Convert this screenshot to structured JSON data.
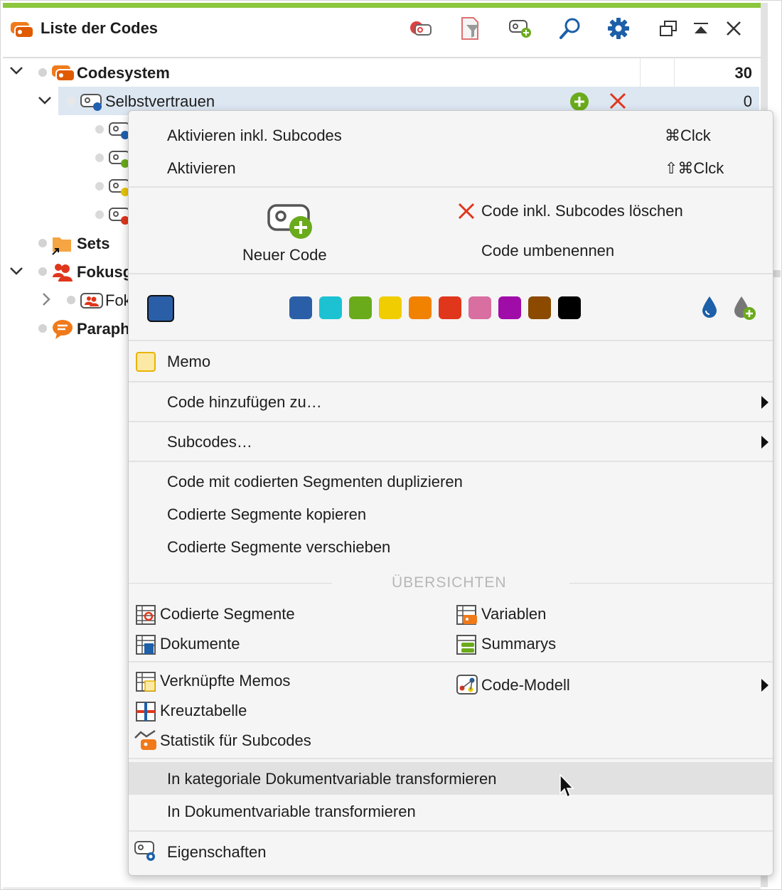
{
  "window": {
    "title": "Liste der Codes",
    "accent_color": "#8cc63e"
  },
  "toolbar": {
    "icons": [
      "code-history-icon",
      "filter-icon",
      "new-code-icon",
      "search-icon",
      "gear-icon",
      "undock-icon",
      "collapse-up-icon",
      "close-icon"
    ]
  },
  "tree": {
    "root": {
      "label": "Codesystem",
      "count": "30"
    },
    "selected": {
      "label": "Selbstvertrauen",
      "count": "0"
    },
    "subcode_colors": [
      "#2060b0",
      "#6aab1c",
      "#e8c400",
      "#e0361c"
    ],
    "sets": {
      "label": "Sets"
    },
    "focus_group": {
      "label": "Fokusg"
    },
    "focus_child": {
      "label": "Fok"
    },
    "paraphrase": {
      "label": "Paraph"
    }
  },
  "menu": {
    "activate_with_sub": {
      "label": "Aktivieren inkl. Subcodes",
      "shortcut": "⌘Clck"
    },
    "activate": {
      "label": "Aktivieren",
      "shortcut": "⇧⌘Clck"
    },
    "new_code": "Neuer Code",
    "delete_code": "Code inkl. Subcodes löschen",
    "rename_code": "Code umbenennen",
    "current_color": "#2a5fa8",
    "palette": [
      "#2a5fa8",
      "#1cc2d2",
      "#6aab1c",
      "#f0cd00",
      "#f08200",
      "#e0361c",
      "#d96ea0",
      "#a00ca8",
      "#8b4a00",
      "#000000"
    ],
    "memo": "Memo",
    "add_code_to": "Code hinzufügen zu…",
    "subcodes": "Subcodes…",
    "duplicate": "Code mit codierten Segmenten duplizieren",
    "copy_segments": "Codierte Segmente kopieren",
    "move_segments": "Codierte Segmente verschieben",
    "overview_header": "ÜBERSICHTEN",
    "coded_segments": "Codierte Segmente",
    "variables": "Variablen",
    "documents": "Dokumente",
    "summaries": "Summarys",
    "linked_memos": "Verknüpfte Memos",
    "code_model": "Code-Modell",
    "crosstab": "Kreuztabelle",
    "statistics": "Statistik für Subcodes",
    "transform_categorical": "In kategoriale Dokumentvariable transformieren",
    "transform_doc_var": "In Dokumentvariable transformieren",
    "properties": "Eigenschaften"
  }
}
